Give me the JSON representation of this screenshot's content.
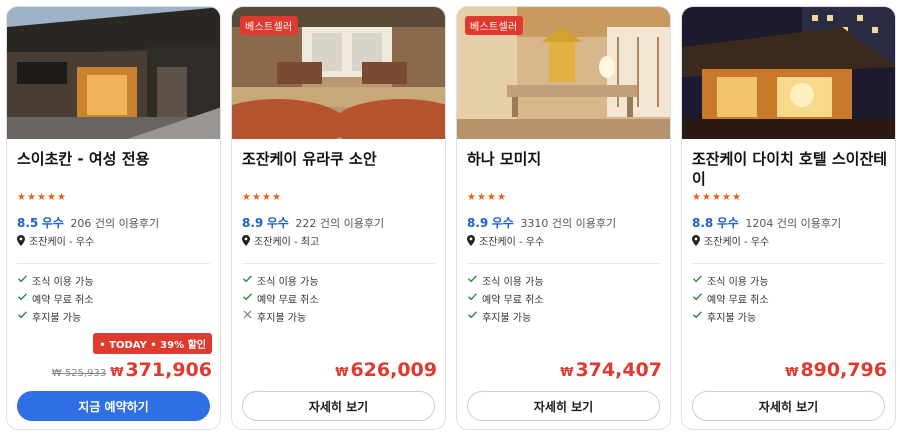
{
  "colors": {
    "accent": "#2f6fe4",
    "price": "#e03a2f",
    "star": "#e8611a",
    "score": "#1c5fd6"
  },
  "hotels": [
    {
      "badge": "",
      "name": "스이초칸 - 여성 전용",
      "stars": 5,
      "score": "8.5",
      "score_label": "우수",
      "reviews": "206 건의 이용후기",
      "location": "조잔케이 - 우수",
      "features": [
        {
          "icon": "check-icon",
          "text": "조식 이용 가능"
        },
        {
          "icon": "check-icon",
          "text": "예약 무료 취소"
        },
        {
          "icon": "check-icon",
          "text": "후지불 가능"
        }
      ],
      "deal": "• TODAY • 39% 할인",
      "old_price": "₩ 525,933",
      "currency": "₩",
      "price": "371,906",
      "button": "지금 예약하기"
    },
    {
      "badge": "베스트셀러",
      "name": "조잔케이 유라쿠 소안",
      "stars": 4,
      "score": "8.9",
      "score_label": "우수",
      "reviews": "222 건의 이용후기",
      "location": "조잔케이 - 최고",
      "features": [
        {
          "icon": "check-icon",
          "text": "조식 이용 가능"
        },
        {
          "icon": "check-icon",
          "text": "예약 무료 취소"
        },
        {
          "icon": "cross-icon",
          "text": "후지불 가능"
        }
      ],
      "deal": "",
      "old_price": "",
      "currency": "₩",
      "price": "626,009",
      "button": "자세히 보기"
    },
    {
      "badge": "베스트셀러",
      "name": "하나 모미지",
      "stars": 4,
      "score": "8.9",
      "score_label": "우수",
      "reviews": "3310 건의 이용후기",
      "location": "조잔케이 - 우수",
      "features": [
        {
          "icon": "check-icon",
          "text": "조식 이용 가능"
        },
        {
          "icon": "check-icon",
          "text": "예약 무료 취소"
        },
        {
          "icon": "check-icon",
          "text": "후지불 가능"
        }
      ],
      "deal": "",
      "old_price": "",
      "currency": "₩",
      "price": "374,407",
      "button": "자세히 보기"
    },
    {
      "badge": "",
      "name": "조잔케이 다이치 호텔 스이잔테이",
      "stars": 5,
      "score": "8.8",
      "score_label": "우수",
      "reviews": "1204 건의 이용후기",
      "location": "조잔케이 - 우수",
      "features": [
        {
          "icon": "check-icon",
          "text": "조식 이용 가능"
        },
        {
          "icon": "check-icon",
          "text": "예약 무료 취소"
        },
        {
          "icon": "check-icon",
          "text": "후지불 가능"
        }
      ],
      "deal": "",
      "old_price": "",
      "currency": "₩",
      "price": "890,796",
      "button": "자세히 보기"
    }
  ]
}
